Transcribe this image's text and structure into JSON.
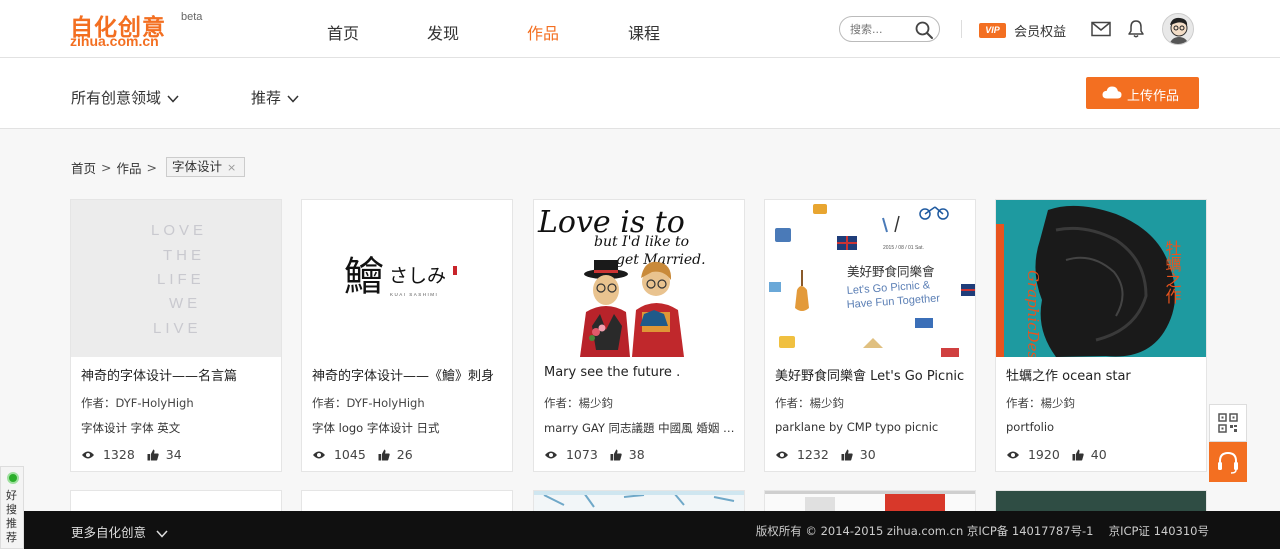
{
  "header": {
    "logo_cn": "自化创意",
    "logo_en": "zihua.com.cn",
    "logo_beta": "beta",
    "nav": [
      {
        "label": "首页",
        "active": false
      },
      {
        "label": "发现",
        "active": false
      },
      {
        "label": "作品",
        "active": true
      },
      {
        "label": "课程",
        "active": false
      }
    ],
    "search_placeholder": "搜索...",
    "vip_badge": "VIP",
    "vip_label": "会员权益"
  },
  "filters": {
    "domain_label": "所有创意领域",
    "sort_label": "推荐",
    "upload_label": "上传作品"
  },
  "breadcrumb": {
    "home": "首页",
    "sep": ">",
    "works": "作品",
    "tag": "字体设计",
    "tag_close": "×"
  },
  "cards": [
    {
      "title": "神奇的字体设计——名言篇",
      "author": "作者：DYF-HolyHigh",
      "tags": "字体设计 字体 英文",
      "views": "1328",
      "likes": "34",
      "image_lines": [
        "LOVE",
        "THE",
        "LIFE",
        "WE",
        "LIVE"
      ]
    },
    {
      "title": "神奇的字体设计——《鱠》刺身",
      "author": "作者：DYF-HolyHigh",
      "tags": "字体 logo 字体设计 日式",
      "views": "1045",
      "likes": "26",
      "image_main": "鱠",
      "image_kana": "さしみ",
      "image_sub": "KUAI SASHIMI"
    },
    {
      "title": "Mary see the future .",
      "author": "作者：楊少鈞",
      "tags": "marry GAY 同志議題 中國風 婚姻 平權",
      "views": "1073",
      "likes": "38",
      "image_line1": "Love is to",
      "image_line2": "but I'd like to",
      "image_line3": "get Married."
    },
    {
      "title": "美好野食同樂會 Let's Go Picnic",
      "author": "作者：楊少鈞",
      "tags": "parklane by CMP typo picnic",
      "views": "1232",
      "likes": "30",
      "image_date": "2015 / 08 / 01 Sat.",
      "image_cn": "美好野食同樂會",
      "image_en1": "Let's Go Picnic &",
      "image_en2": "Have Fun Together"
    },
    {
      "title": "牡蠣之作 ocean star",
      "author": "作者：楊少鈞",
      "tags": "portfolio",
      "views": "1920",
      "likes": "40",
      "image_side": "牡蠣之作",
      "image_vertical": "GraphicDesign"
    }
  ],
  "footer": {
    "more_label": "更多自化创意",
    "copyright": "版权所有 © 2014-2015 zihua.com.cn 京ICP备 14017787号-1 　京ICP证 140310号"
  },
  "left_widget": {
    "text": "好搜推荐"
  },
  "colors": {
    "accent": "#f36f21",
    "footer_bg": "#101010",
    "teal": "#1e9aa0"
  }
}
